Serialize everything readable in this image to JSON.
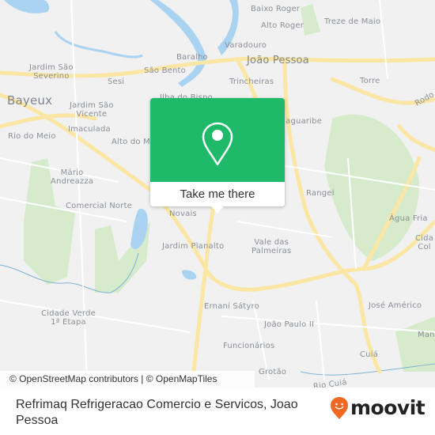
{
  "map": {
    "labels": {
      "baixo_roger": "Baixo Roger",
      "treze_de_maio": "Treze de Maio",
      "alto_roger": "Alto Roger",
      "varadouro": "Varadouro",
      "joao_pessoa": "João Pessoa",
      "baralho": "Baralho",
      "jardim_sao_severino": "Jardim São\nSeverino",
      "sesi": "Sesi",
      "sao_bento": "São Bento",
      "trincheiras": "Trincheiras",
      "torre": "Torre",
      "bayeux": "Bayeux",
      "jardim_sao_vicente": "Jardim São\nVicente",
      "ilha_do_bispo": "Ilha do Bispo",
      "jaguaribe": "Jaguaribe",
      "rodovia": "Rodo",
      "imaculada": "Imaculada",
      "rio_do_meio": "Rio do Meio",
      "alto_do_mateus": "Alto do M",
      "mario_andreazza": "Mário\nAndreazza",
      "comercial_norte": "Comercial Norte",
      "rangel": "Rangel",
      "novais": "Novais",
      "agua_fria": "Água Fria",
      "cidade_col": "Cida\nCol",
      "jardim_planalto": "Jardim Planalto",
      "vale_das_palmeiras": "Vale das\nPalmeiras",
      "cidade_verde": "Cidade Verde\n1ª Etapa",
      "ernani_satyro": "Ernani Sátyro",
      "jose_americo": "José Américo",
      "joao_paulo_ii": "João Paulo II",
      "funcionarios": "Funcionários",
      "cuia": "Cuiá",
      "grotao": "Grotão",
      "rio_cuia": "Rio Cuiá",
      "man": "Man"
    },
    "attribution": "© OpenStreetMap contributors | © OpenMapTiles",
    "colors": {
      "background": "#f1f1f1",
      "water": "#aad3f2",
      "park": "#d6ebcb",
      "major_road": "#fbe6a3",
      "minor_road": "#ffffff"
    }
  },
  "popup": {
    "icon": "map-pin-icon",
    "button_label": "Take me there",
    "color": "#1fb96a"
  },
  "footer": {
    "title": "Refrimaq Refrigeracao Comercio e Servicos, Joao Pessoa",
    "brand": "moovit",
    "brand_icon": "moovit-smiley-pin-icon",
    "brand_color": "#f26722"
  }
}
